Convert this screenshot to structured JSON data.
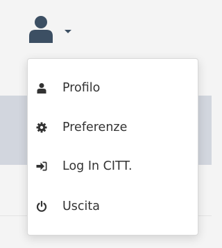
{
  "header": {
    "user_icon": "user-icon",
    "caret_icon": "caret-down-icon",
    "icon_color": "#3c4f63"
  },
  "menu": {
    "items": [
      {
        "label": "Profilo",
        "icon": "user-icon"
      },
      {
        "label": "Preferenze",
        "icon": "gear-icon"
      },
      {
        "label": "Log In CITT.",
        "icon": "sign-in-icon"
      },
      {
        "label": "Uscita",
        "icon": "power-icon"
      }
    ]
  }
}
